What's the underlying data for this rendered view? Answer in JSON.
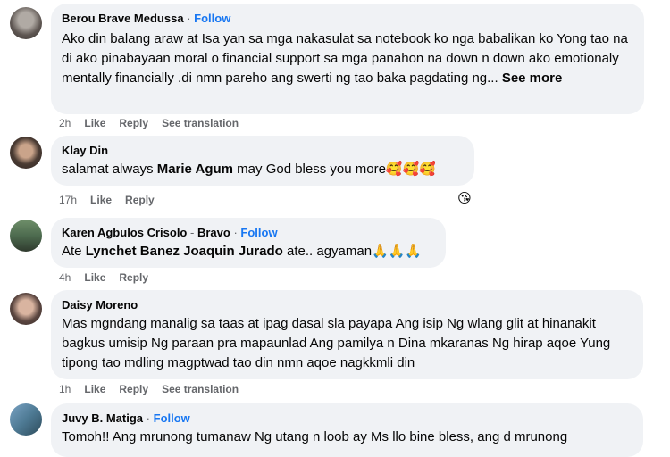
{
  "comments": [
    {
      "name": "Berou Brave Medussa",
      "follow": "Follow",
      "text": "Ako din balang araw at Isa yan sa mga nakasulat sa notebook ko nga babalikan ko Yong tao na di ako pinabayaan moral o financial support sa mga panahon na down n down ako emotionaly mentally financially .di nmn pareho ang swerti ng tao baka pagdating ng...",
      "see_more": "See more",
      "time": "2h",
      "like": "Like",
      "reply": "Reply",
      "translate": "See translation"
    },
    {
      "name": "Klay Din",
      "text_before": "salamat always ",
      "mention": "Marie Agum",
      "text_after": " may God bless you more🥰🥰🥰",
      "time": "17h",
      "like": "Like",
      "reply": "Reply",
      "reaction": "😘"
    },
    {
      "name": "Karen Agbulos Crisolo",
      "badge": "Bravo",
      "follow": "Follow",
      "text_before": "Ate ",
      "mention": "Lynchet Banez Joaquin Jurado",
      "text_after": " ate.. agyaman🙏🙏🙏",
      "time": "4h",
      "like": "Like",
      "reply": "Reply"
    },
    {
      "name": "Daisy Moreno",
      "text": "Mas mgndang manalig sa taas at ipag dasal sla payapa Ang isip Ng wlang glit at hinanakit bagkus umisip Ng paraan pra mapaunlad Ang pamilya n Dina mkaranas Ng hirap aqoe Yung tipong tao mdling magptwad tao din nmn aqoe nagkkmli din",
      "time": "1h",
      "like": "Like",
      "reply": "Reply",
      "translate": "See translation"
    },
    {
      "name": "Juvy B. Matiga",
      "follow": "Follow",
      "text": "Tomoh!! Ang mrunong tumanaw Ng utang n loob ay Ms llo bine bless, ang d mrunong"
    }
  ]
}
